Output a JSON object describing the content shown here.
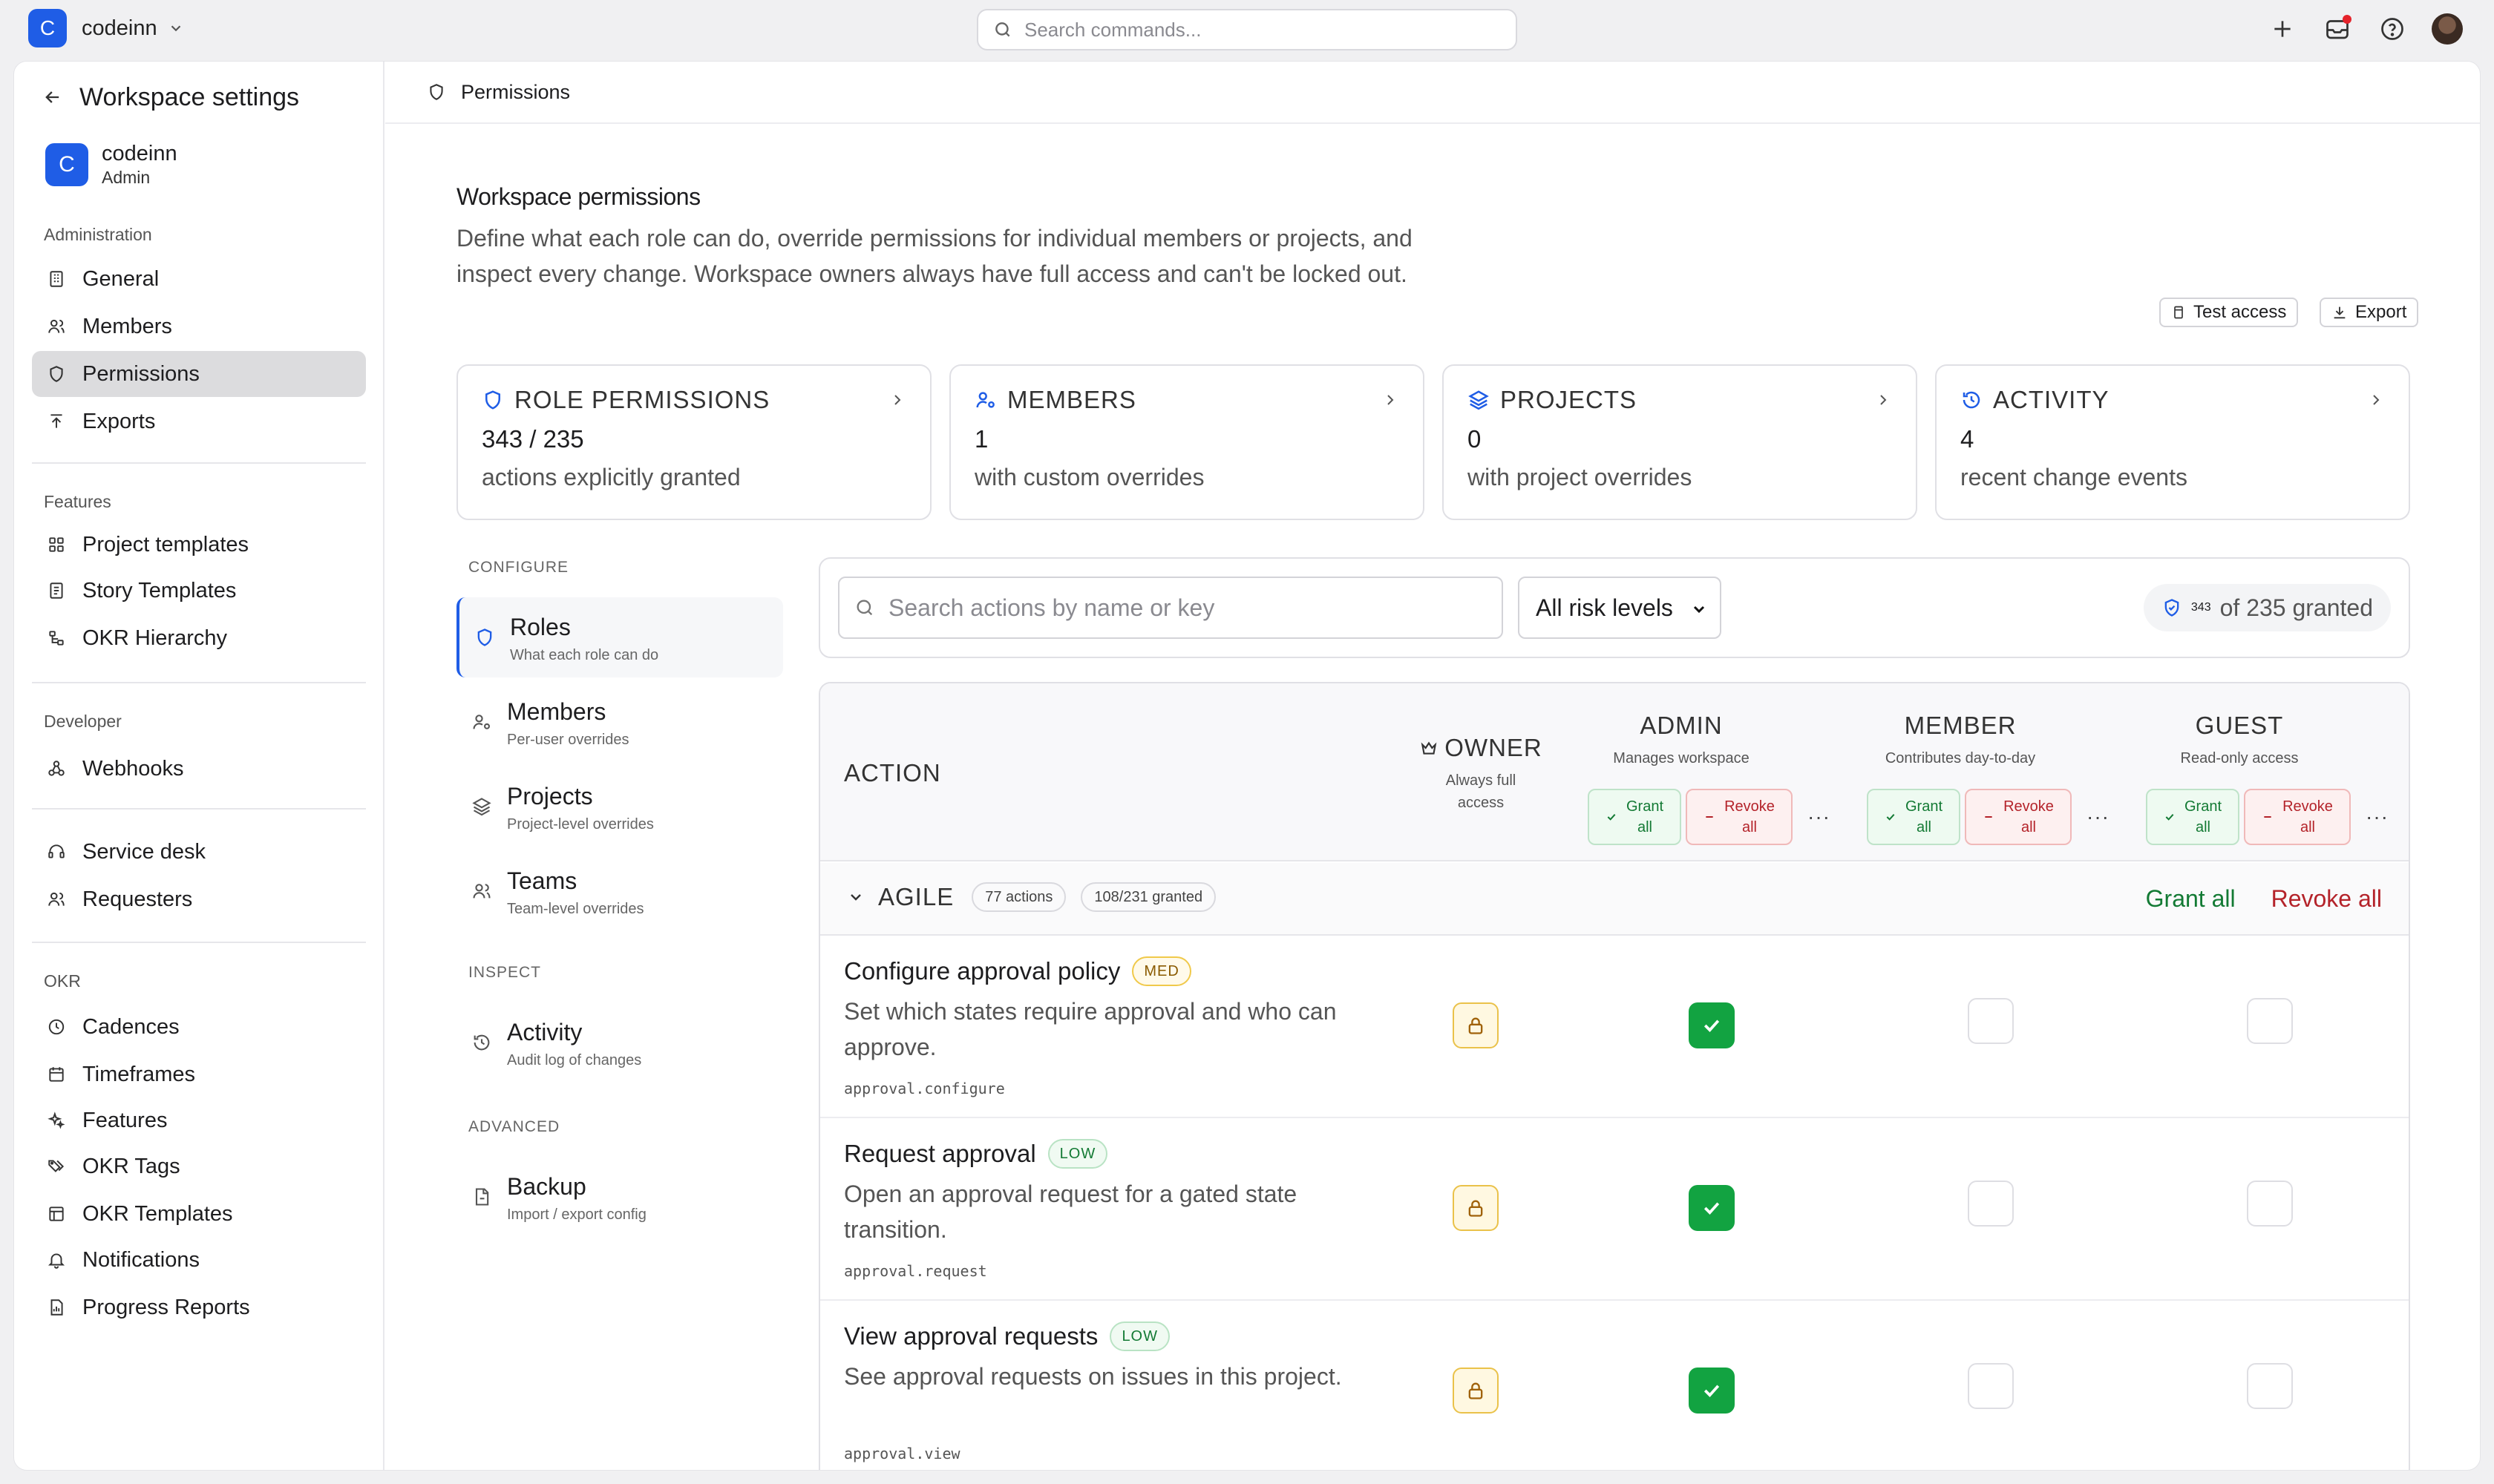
{
  "topbar": {
    "workspace_initial": "C",
    "workspace_name": "codeinn",
    "search_placeholder": "Search commands...",
    "icons": [
      "plus-icon",
      "inbox-icon",
      "help-icon",
      "avatar"
    ],
    "notification_color": "#e5232b"
  },
  "sidebar": {
    "title": "Workspace settings",
    "workspace": {
      "initial": "C",
      "name": "codeinn",
      "role": "Admin"
    },
    "sections": [
      {
        "label": "Administration",
        "items": [
          "General",
          "Members",
          "Permissions",
          "Exports"
        ]
      },
      {
        "label": "Features",
        "items": [
          "Project templates",
          "Story Templates",
          "OKR Hierarchy"
        ]
      },
      {
        "label": "Developer",
        "items": [
          "Webhooks"
        ]
      },
      {
        "label": "",
        "items": [
          "Service desk",
          "Requesters"
        ]
      },
      {
        "label": "OKR",
        "items": [
          "Cadences",
          "Timeframes",
          "Features",
          "OKR Tags",
          "OKR Templates",
          "Notifications",
          "Progress Reports"
        ]
      }
    ],
    "active_item": "Permissions"
  },
  "breadcrumb": {
    "label": "Permissions"
  },
  "header": {
    "title": "Workspace permissions",
    "description": "Define what each role can do, override permissions for individual members or projects, and inspect every change. Workspace owners always have full access and can't be locked out.",
    "test_access_label": "Test access",
    "export_label": "Export"
  },
  "cards": [
    {
      "title": "ROLE PERMISSIONS",
      "value": "343 / 235",
      "sub": "actions explicitly granted"
    },
    {
      "title": "MEMBERS",
      "value": "1",
      "sub": "with custom overrides"
    },
    {
      "title": "PROJECTS",
      "value": "0",
      "sub": "with project overrides"
    },
    {
      "title": "ACTIVITY",
      "value": "4",
      "sub": "recent change events"
    }
  ],
  "config_nav": {
    "configure_label": "CONFIGURE",
    "inspect_label": "INSPECT",
    "advanced_label": "ADVANCED",
    "items": [
      {
        "title": "Roles",
        "sub": "What each role can do"
      },
      {
        "title": "Members",
        "sub": "Per-user overrides"
      },
      {
        "title": "Projects",
        "sub": "Project-level overrides"
      },
      {
        "title": "Teams",
        "sub": "Team-level overrides"
      },
      {
        "title": "Activity",
        "sub": "Audit log of changes"
      },
      {
        "title": "Backup",
        "sub": "Import / export config"
      }
    ],
    "active": "Roles"
  },
  "filters": {
    "search_placeholder": "Search actions by name or key",
    "risk_select": "All risk levels",
    "granted_count": "343",
    "granted_suffix": "of 235 granted"
  },
  "table": {
    "action_header": "ACTION",
    "roles": [
      {
        "name": "OWNER",
        "desc": "Always full access"
      },
      {
        "name": "ADMIN",
        "desc": "Manages workspace"
      },
      {
        "name": "MEMBER",
        "desc": "Contributes day-to-day"
      },
      {
        "name": "GUEST",
        "desc": "Read-only access"
      }
    ],
    "grant_all_btn": "Grant all",
    "revoke_all_btn": "Revoke all",
    "more": "···",
    "group": {
      "name": "AGILE",
      "actions_chip": "77 actions",
      "granted_chip": "108/231 granted",
      "grant_all": "Grant all",
      "revoke_all": "Revoke all"
    },
    "rows": [
      {
        "name": "Configure approval policy",
        "risk": "MED",
        "desc": "Set which states require approval and who can approve.",
        "key": "approval.configure"
      },
      {
        "name": "Request approval",
        "risk": "LOW",
        "desc": "Open an approval request for a gated state transition.",
        "key": "approval.request"
      },
      {
        "name": "View approval requests",
        "risk": "LOW",
        "desc": "See approval requests on issues in this project.",
        "key": "approval.view"
      }
    ]
  },
  "colors": {
    "brand": "#1f5de6",
    "granted": "#12a341",
    "grant_text": "#137a34",
    "revoke_text": "#b4232a"
  }
}
